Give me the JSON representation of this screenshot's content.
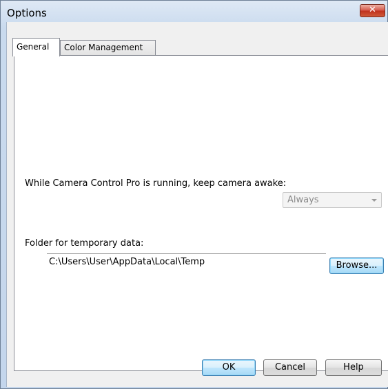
{
  "window": {
    "title": "Options",
    "close_symbol": "✕"
  },
  "tabs": [
    {
      "label": "General",
      "active": true
    },
    {
      "label": "Color Management",
      "active": false
    }
  ],
  "general": {
    "keep_awake_label": "While Camera Control Pro is running, keep camera awake:",
    "keep_awake_value": "Always",
    "temp_folder_label": "Folder for temporary data:",
    "temp_folder_path": "C:\\Users\\User\\AppData\\Local\\Temp",
    "browse_label": "Browse..."
  },
  "footer": {
    "ok_label": "OK",
    "cancel_label": "Cancel",
    "help_label": "Help"
  }
}
